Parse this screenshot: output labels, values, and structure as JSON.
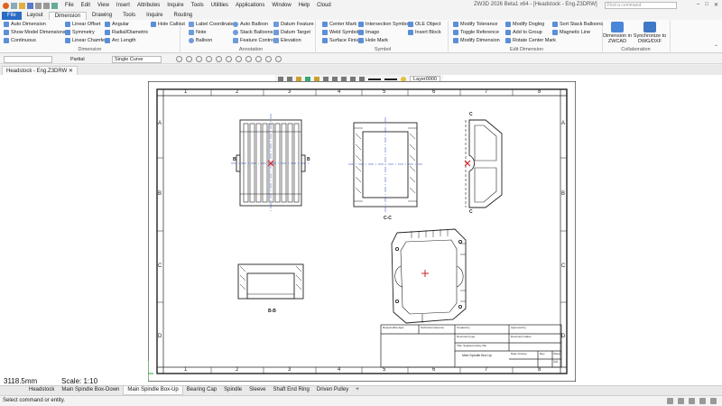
{
  "window": {
    "title": "ZW3D 2026 Beta1 x64 - [Headstock - Eng.Z3DRW]",
    "search_placeholder": "Find a command",
    "menu": [
      "File",
      "Edit",
      "View",
      "Insert",
      "Attributes",
      "Inquire",
      "Tools",
      "Utilities",
      "Applications",
      "Window",
      "Help",
      "Cloud"
    ],
    "controls": [
      "–",
      "□",
      "✕"
    ]
  },
  "ribbon_tabs": [
    "File",
    "Layout",
    "Dimension",
    "Drawing",
    "Tools",
    "Inquire",
    "Routing"
  ],
  "ribbon": {
    "dimension": {
      "label": "Dimension",
      "items": [
        "Auto Dimension",
        "Show Model Dimensions",
        "Continuous",
        "Linear Offset",
        "Symmetry",
        "Linear Chamfer",
        "Angular",
        "Radial/Diametric",
        "Arc Length",
        "Hole Callout"
      ]
    },
    "annotation": {
      "label": "Annotation",
      "items": [
        "Label Coordinate",
        "Note",
        "Balloon",
        "Auto Balloon",
        "Stack Balloons",
        "Feature Control",
        "Datum Feature",
        "Datum Target",
        "Elevation"
      ]
    },
    "symbol": {
      "label": "Symbol",
      "items": [
        "Center Mark",
        "Weld Symbol",
        "Surface Finish",
        "Intersection Symbol",
        "Image",
        "Hole Mark",
        "OLE Object",
        "Insert Block"
      ]
    },
    "edit_dimension": {
      "label": "Edit Dimension",
      "items": [
        "Modify Tolerance",
        "Toggle Reference",
        "Modify Dimension",
        "Modify Dogleg",
        "Add to Group",
        "Rotate Center Mark",
        "Sort Stack Balloons",
        "Magnetic Line"
      ]
    },
    "collaboration": {
      "label": "Collaboration",
      "items": [
        "Dimension in ZWCAD",
        "Synchronize to DWG/DXF"
      ]
    }
  },
  "command_bar": {
    "filter": "",
    "mode": "Partial",
    "curve": "Single Curve"
  },
  "document_tab": "Headstock - Eng.Z3DRW",
  "view_bar": {
    "layer": "Layer0000"
  },
  "sheet": {
    "border_cols": [
      "1",
      "2",
      "3",
      "4",
      "5",
      "6",
      "7",
      "8"
    ],
    "border_rows": [
      "A",
      "B",
      "C",
      "D"
    ],
    "view_labels": [
      "B",
      "B",
      "C",
      "C",
      "C-C",
      "B-B"
    ],
    "title_block": {
      "responsible": "Responsible dept.",
      "technical": "Technical reference",
      "created": "Created by",
      "approved": "Approved by",
      "doc_type": "Document type",
      "doc_status": "Document status",
      "title": "Title, Supplementary title",
      "drawing_name": "Main Spindle Box-Up",
      "rev": "Rev.",
      "date": "Date of issue",
      "sheet": "Sheet",
      "sheet_val": "1/4"
    }
  },
  "readout": {
    "coordinate": "3118.5mm",
    "scale": "Scale: 1:10"
  },
  "sheet_tabs": [
    "Headstock",
    "Main Spindle Box-Down",
    "Main Spindle Box-Up",
    "Bearing Cap",
    "Spindle",
    "Sleeve",
    "Shaft End Ring",
    "Driven Pulley"
  ],
  "active_sheet_tab": "Main Spindle Box-Up",
  "status": "Select command or entity.",
  "colors": {
    "file_tab": "#2a6bc4",
    "center_line": "#1f3fb0",
    "mark": "#d22020",
    "axis_green": "#2e9e3e"
  }
}
